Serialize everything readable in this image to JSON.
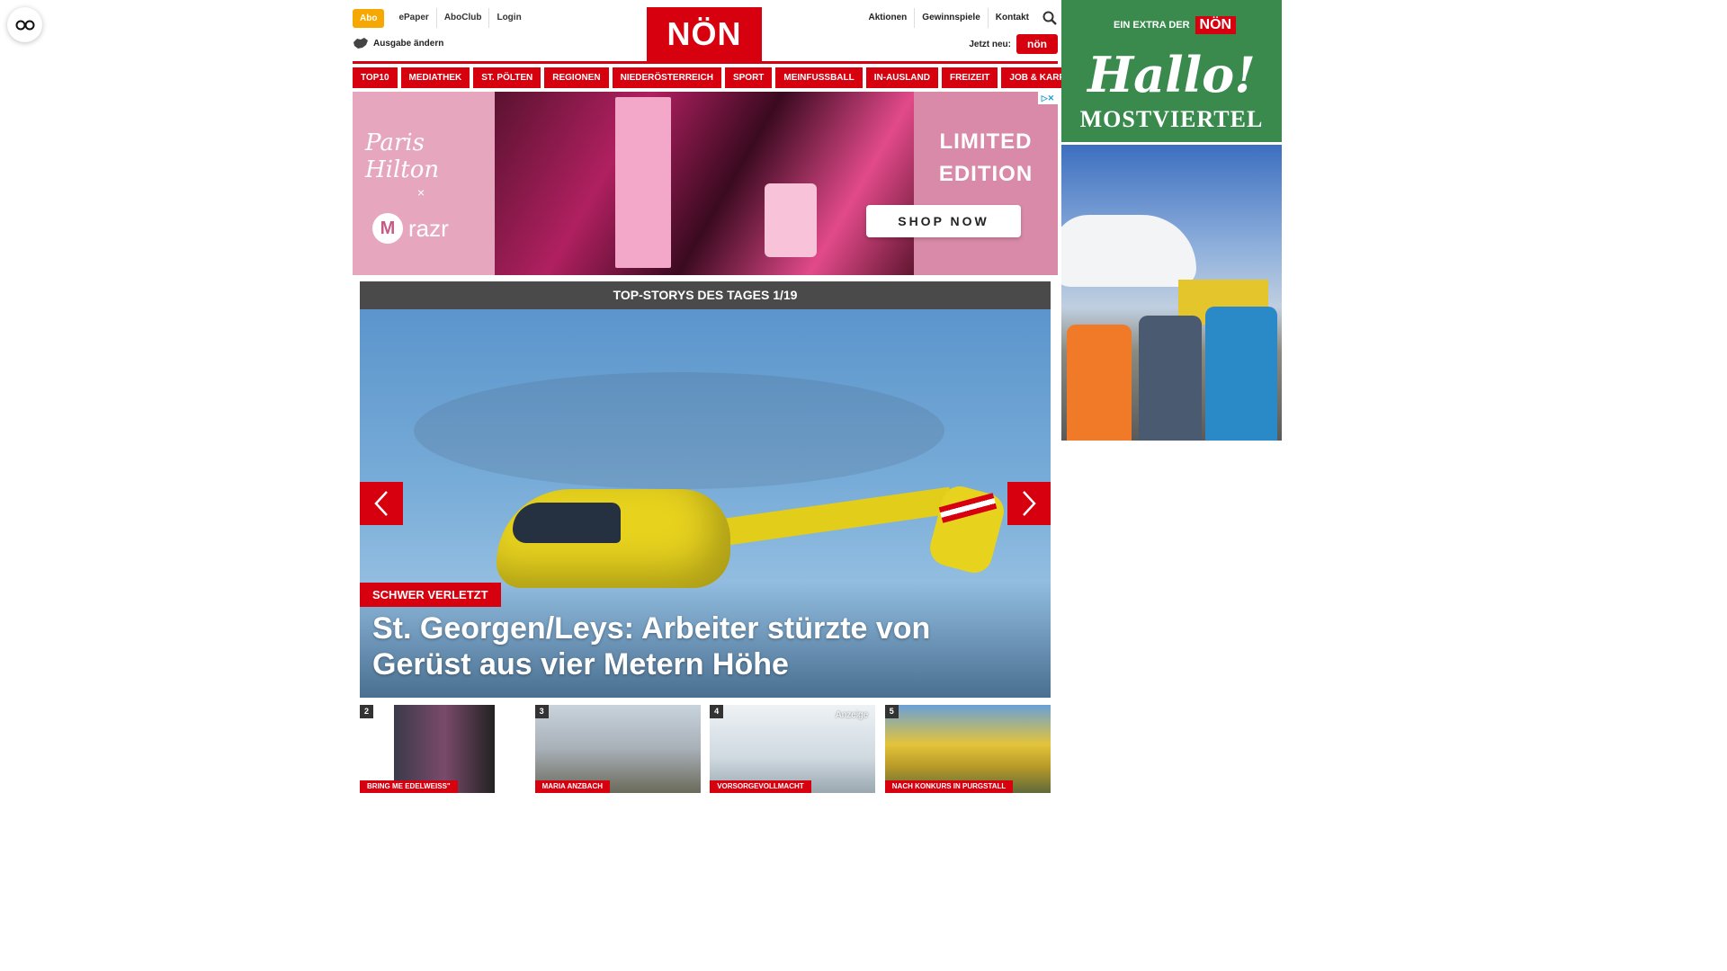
{
  "floating": {
    "icon": "glasses-icon"
  },
  "header": {
    "abo": "Abo",
    "links_left": [
      "ePaper",
      "AboClub",
      "Login"
    ],
    "ausgabe": "Ausgabe ändern",
    "logo": "NÖN",
    "links_right": [
      "Aktionen",
      "Gewinnspiele",
      "Kontakt"
    ],
    "jetzt_neu": "Jetzt neu:",
    "jetzt_badge": "nön"
  },
  "nav": [
    "TOP10",
    "MEDIATHEK",
    "ST. PÖLTEN",
    "REGIONEN",
    "NIEDERÖSTERREICH",
    "SPORT",
    "MEINFUSSBALL",
    "IN-AUSLAND",
    "FREIZEIT",
    "JOB & KARRIERE"
  ],
  "ad": {
    "brand": "Paris Hilton",
    "x": "×",
    "partner": "razr",
    "moto": "M",
    "limited": [
      "LIMITED",
      "EDITION"
    ],
    "cta": "SHOP NOW"
  },
  "hero": {
    "header": "TOP-STORYS DES TAGES 1/19",
    "tag": "SCHWER VERLETZT",
    "title": "St. Georgen/Leys: Arbeiter stürzte von Gerüst aus vier Metern Höhe"
  },
  "thumbs": [
    {
      "num": "2",
      "caption": "BRING ME EDELWEISS\""
    },
    {
      "num": "3",
      "caption": "MARIA ANZBACH"
    },
    {
      "num": "4",
      "caption": "VORSORGEVOLLMACHT",
      "label": "Anzeige"
    },
    {
      "num": "5",
      "caption": "NACH KONKURS IN PURGSTALL"
    }
  ],
  "sidebar": {
    "extra": "EIN EXTRA DER",
    "extra_brand": "NÖN",
    "hallo": "Hallo!",
    "region": "MOSTVIERTEL"
  },
  "colors": {
    "brand_red": "#d7000f",
    "abo_orange": "#f6a800",
    "sidebar_green": "#3a8a4e"
  }
}
